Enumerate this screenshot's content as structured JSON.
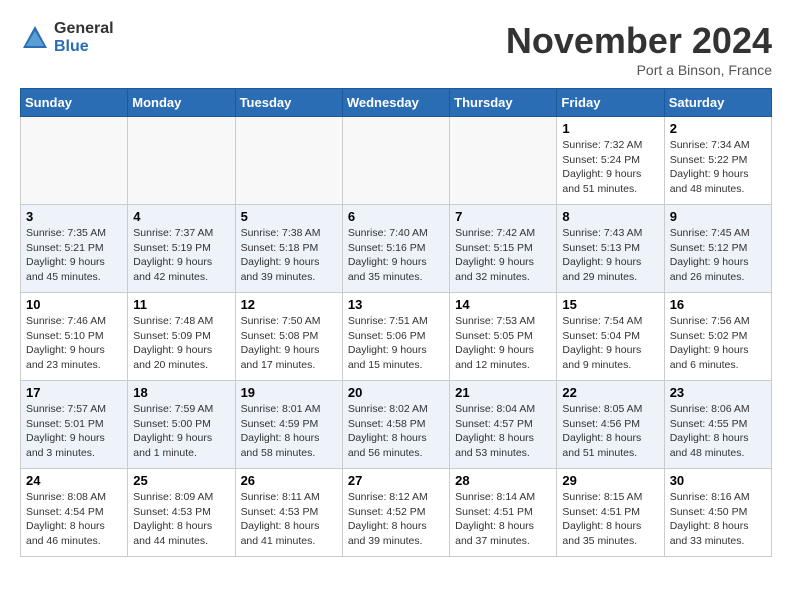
{
  "logo": {
    "general": "General",
    "blue": "Blue"
  },
  "title": "November 2024",
  "location": "Port a Binson, France",
  "weekdays": [
    "Sunday",
    "Monday",
    "Tuesday",
    "Wednesday",
    "Thursday",
    "Friday",
    "Saturday"
  ],
  "weeks": [
    [
      {
        "day": "",
        "info": ""
      },
      {
        "day": "",
        "info": ""
      },
      {
        "day": "",
        "info": ""
      },
      {
        "day": "",
        "info": ""
      },
      {
        "day": "",
        "info": ""
      },
      {
        "day": "1",
        "info": "Sunrise: 7:32 AM\nSunset: 5:24 PM\nDaylight: 9 hours\nand 51 minutes."
      },
      {
        "day": "2",
        "info": "Sunrise: 7:34 AM\nSunset: 5:22 PM\nDaylight: 9 hours\nand 48 minutes."
      }
    ],
    [
      {
        "day": "3",
        "info": "Sunrise: 7:35 AM\nSunset: 5:21 PM\nDaylight: 9 hours\nand 45 minutes."
      },
      {
        "day": "4",
        "info": "Sunrise: 7:37 AM\nSunset: 5:19 PM\nDaylight: 9 hours\nand 42 minutes."
      },
      {
        "day": "5",
        "info": "Sunrise: 7:38 AM\nSunset: 5:18 PM\nDaylight: 9 hours\nand 39 minutes."
      },
      {
        "day": "6",
        "info": "Sunrise: 7:40 AM\nSunset: 5:16 PM\nDaylight: 9 hours\nand 35 minutes."
      },
      {
        "day": "7",
        "info": "Sunrise: 7:42 AM\nSunset: 5:15 PM\nDaylight: 9 hours\nand 32 minutes."
      },
      {
        "day": "8",
        "info": "Sunrise: 7:43 AM\nSunset: 5:13 PM\nDaylight: 9 hours\nand 29 minutes."
      },
      {
        "day": "9",
        "info": "Sunrise: 7:45 AM\nSunset: 5:12 PM\nDaylight: 9 hours\nand 26 minutes."
      }
    ],
    [
      {
        "day": "10",
        "info": "Sunrise: 7:46 AM\nSunset: 5:10 PM\nDaylight: 9 hours\nand 23 minutes."
      },
      {
        "day": "11",
        "info": "Sunrise: 7:48 AM\nSunset: 5:09 PM\nDaylight: 9 hours\nand 20 minutes."
      },
      {
        "day": "12",
        "info": "Sunrise: 7:50 AM\nSunset: 5:08 PM\nDaylight: 9 hours\nand 17 minutes."
      },
      {
        "day": "13",
        "info": "Sunrise: 7:51 AM\nSunset: 5:06 PM\nDaylight: 9 hours\nand 15 minutes."
      },
      {
        "day": "14",
        "info": "Sunrise: 7:53 AM\nSunset: 5:05 PM\nDaylight: 9 hours\nand 12 minutes."
      },
      {
        "day": "15",
        "info": "Sunrise: 7:54 AM\nSunset: 5:04 PM\nDaylight: 9 hours\nand 9 minutes."
      },
      {
        "day": "16",
        "info": "Sunrise: 7:56 AM\nSunset: 5:02 PM\nDaylight: 9 hours\nand 6 minutes."
      }
    ],
    [
      {
        "day": "17",
        "info": "Sunrise: 7:57 AM\nSunset: 5:01 PM\nDaylight: 9 hours\nand 3 minutes."
      },
      {
        "day": "18",
        "info": "Sunrise: 7:59 AM\nSunset: 5:00 PM\nDaylight: 9 hours\nand 1 minute."
      },
      {
        "day": "19",
        "info": "Sunrise: 8:01 AM\nSunset: 4:59 PM\nDaylight: 8 hours\nand 58 minutes."
      },
      {
        "day": "20",
        "info": "Sunrise: 8:02 AM\nSunset: 4:58 PM\nDaylight: 8 hours\nand 56 minutes."
      },
      {
        "day": "21",
        "info": "Sunrise: 8:04 AM\nSunset: 4:57 PM\nDaylight: 8 hours\nand 53 minutes."
      },
      {
        "day": "22",
        "info": "Sunrise: 8:05 AM\nSunset: 4:56 PM\nDaylight: 8 hours\nand 51 minutes."
      },
      {
        "day": "23",
        "info": "Sunrise: 8:06 AM\nSunset: 4:55 PM\nDaylight: 8 hours\nand 48 minutes."
      }
    ],
    [
      {
        "day": "24",
        "info": "Sunrise: 8:08 AM\nSunset: 4:54 PM\nDaylight: 8 hours\nand 46 minutes."
      },
      {
        "day": "25",
        "info": "Sunrise: 8:09 AM\nSunset: 4:53 PM\nDaylight: 8 hours\nand 44 minutes."
      },
      {
        "day": "26",
        "info": "Sunrise: 8:11 AM\nSunset: 4:53 PM\nDaylight: 8 hours\nand 41 minutes."
      },
      {
        "day": "27",
        "info": "Sunrise: 8:12 AM\nSunset: 4:52 PM\nDaylight: 8 hours\nand 39 minutes."
      },
      {
        "day": "28",
        "info": "Sunrise: 8:14 AM\nSunset: 4:51 PM\nDaylight: 8 hours\nand 37 minutes."
      },
      {
        "day": "29",
        "info": "Sunrise: 8:15 AM\nSunset: 4:51 PM\nDaylight: 8 hours\nand 35 minutes."
      },
      {
        "day": "30",
        "info": "Sunrise: 8:16 AM\nSunset: 4:50 PM\nDaylight: 8 hours\nand 33 minutes."
      }
    ]
  ]
}
